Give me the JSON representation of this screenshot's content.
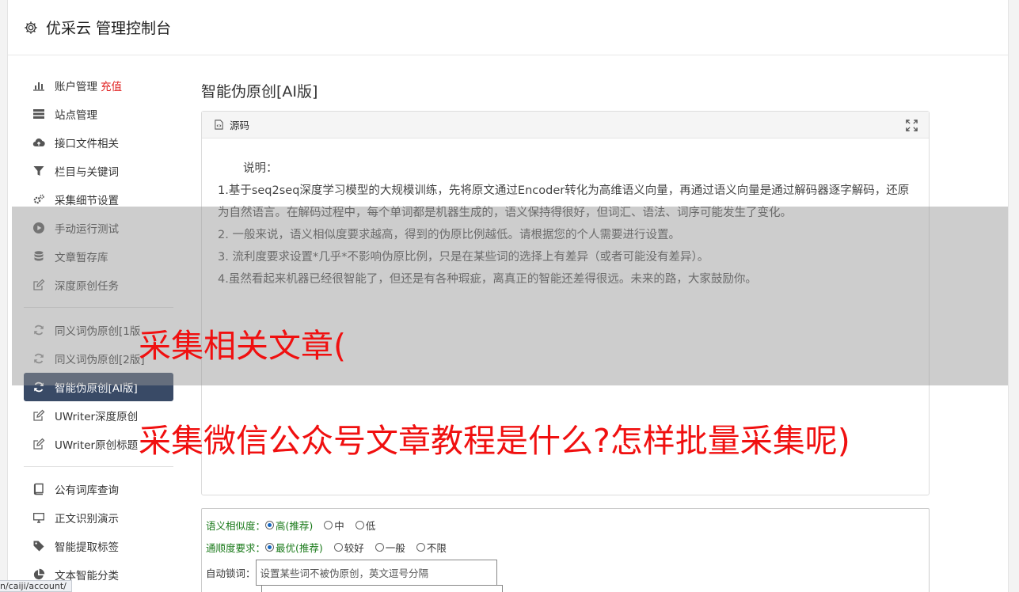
{
  "app": {
    "title": "优采云 管理控制台"
  },
  "sidebar": {
    "group1": [
      {
        "label": "账户管理",
        "badge": "充值",
        "icon": "bar-chart-icon"
      },
      {
        "label": "站点管理",
        "icon": "server-icon"
      },
      {
        "label": "接口文件相关",
        "icon": "cloud-upload-icon"
      },
      {
        "label": "栏目与关键词",
        "icon": "filter-icon"
      },
      {
        "label": "采集细节设置",
        "icon": "gears-icon"
      },
      {
        "label": "手动运行测试",
        "icon": "play-icon"
      },
      {
        "label": "文章暂存库",
        "icon": "database-icon"
      },
      {
        "label": "深度原创任务",
        "icon": "edit-icon"
      }
    ],
    "group2": [
      {
        "label": "同义词伪原创[1版",
        "icon": "refresh-icon"
      },
      {
        "label": "同义词伪原创[2版]",
        "icon": "refresh-icon"
      },
      {
        "label": "智能伪原创[AI版]",
        "icon": "refresh-icon",
        "active": true
      },
      {
        "label": "UWriter深度原创",
        "icon": "edit-icon"
      },
      {
        "label": "UWriter原创标题",
        "icon": "edit-icon"
      }
    ],
    "group3": [
      {
        "label": "公有词库查询",
        "icon": "book-icon"
      },
      {
        "label": "正文识别演示",
        "icon": "monitor-icon"
      },
      {
        "label": "智能提取标签",
        "icon": "tag-icon"
      },
      {
        "label": "文本智能分类",
        "icon": "pie-chart-icon"
      }
    ]
  },
  "main": {
    "page_title": "智能伪原创[AI版]",
    "panel": {
      "header": "源码",
      "intro": "说明：",
      "lines": [
        "1.基于seq2seq深度学习模型的大规模训练，先将原文通过Encoder转化为高维语义向量，再通过语义向量是通过解码器逐字解码，还原为自然语言。在解码过程中，每个单词都是机器生成的，语义保持得很好，但词汇、语法、词序可能发生了变化。",
        "2. 一般来说，语义相似度要求越高，得到的伪原比例越低。请根据您的个人需要进行设置。",
        "3. 流利度要求设置*几乎*不影响伪原比例，只是在某些词的选择上有差异（或者可能没有差异）。",
        "4.虽然看起来机器已经很智能了，但还是有各种瑕疵，离真正的智能还差得很远。未来的路，大家鼓励你。"
      ]
    },
    "form": {
      "similarity_label": "语义相似度：",
      "similarity_options": [
        "高(推荐)",
        "中",
        "低"
      ],
      "fluency_label": "通顺度要求：",
      "fluency_options": [
        "最优(推荐)",
        "较好",
        "一般",
        "不限"
      ],
      "lock_label": "自动锁词：",
      "lock_placeholder": "设置某些词不被伪原创，英文逗号分隔"
    }
  },
  "overlay": {
    "headline1": "采集相关文章(",
    "headline2": "采集微信公众号文章教程是什么?怎样批量采集呢)"
  },
  "status_bar": {
    "url": "n/caiji/account/"
  },
  "colors": {
    "active_bg": "#394a66",
    "red": "#e02020",
    "green_label": "#1a7a1a",
    "headline": "#f01010"
  }
}
